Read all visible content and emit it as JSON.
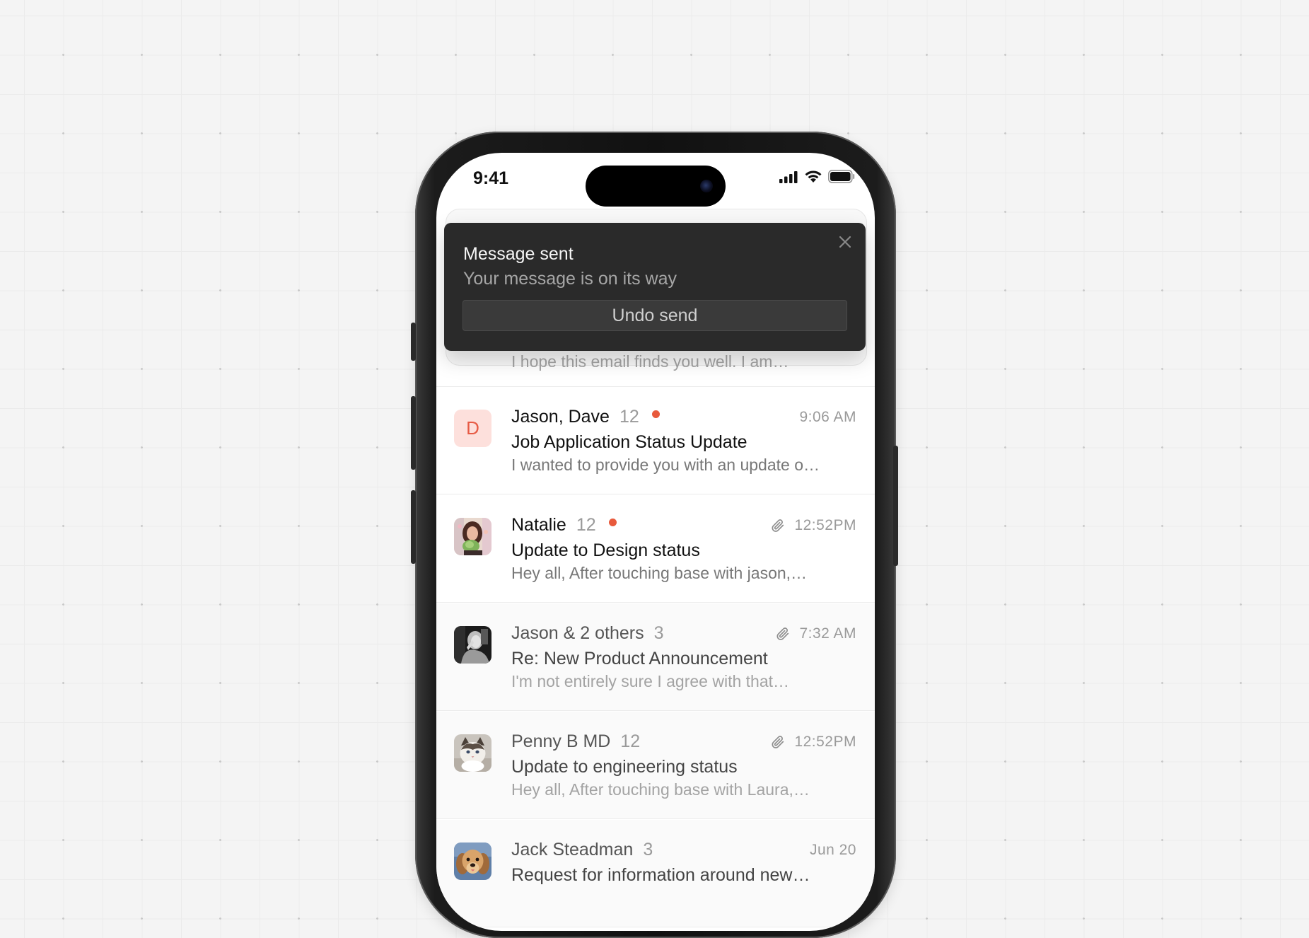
{
  "status_bar": {
    "time": "9:41"
  },
  "background_preview": "I hope this email finds you well. I am…",
  "toast": {
    "title": "Message sent",
    "subtitle": "Your message is on its way",
    "undo_label": "Undo send"
  },
  "emails": [
    {
      "sender": "Jason, Dave",
      "count": "12",
      "unread": true,
      "attachment": false,
      "time": "9:06 AM",
      "subject": "Job Application Status Update",
      "preview": "I wanted to provide you with an update o…",
      "avatar": {
        "type": "letter",
        "letter": "D",
        "bg": "#fde0dc",
        "fg": "#e75b45"
      }
    },
    {
      "sender": "Natalie",
      "count": "12",
      "unread": true,
      "attachment": true,
      "time": "12:52PM",
      "subject": "Update to Design status",
      "preview": "Hey all, After touching base with jason,…",
      "avatar": {
        "type": "photo",
        "subject": "woman-portrait"
      }
    },
    {
      "sender": "Jason & 2 others",
      "count": "3",
      "unread": false,
      "attachment": true,
      "time": "7:32 AM",
      "subject": "Re: New Product Announcement",
      "preview": "I'm not entirely sure I agree with that…",
      "avatar": {
        "type": "photo",
        "subject": "bw-portrait"
      }
    },
    {
      "sender": "Penny B MD",
      "count": "12",
      "unread": false,
      "attachment": true,
      "time": "12:52PM",
      "subject": "Update to engineering status",
      "preview": "Hey all, After touching base with Laura,…",
      "avatar": {
        "type": "photo",
        "subject": "cat-portrait"
      }
    },
    {
      "sender": "Jack Steadman",
      "count": "3",
      "unread": false,
      "attachment": false,
      "time": "Jun 20",
      "subject": "Request for information around new…",
      "preview": "",
      "avatar": {
        "type": "photo",
        "subject": "dog-portrait"
      }
    }
  ],
  "colors": {
    "unread_dot": "#e85a3c",
    "toast_bg": "#2a2a2a",
    "letter_avatar_bg": "#fde0dc",
    "letter_avatar_fg": "#e75b45"
  }
}
